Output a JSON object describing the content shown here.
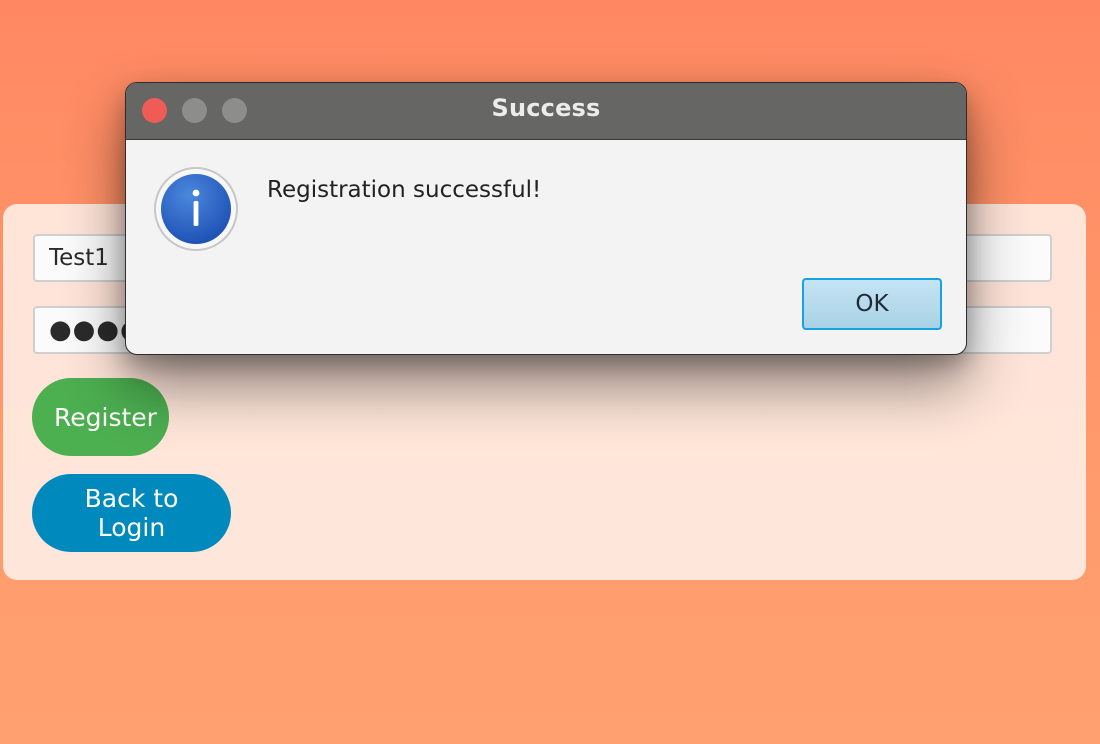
{
  "form": {
    "username_value": "Test1",
    "password_value": "●●●●●●●",
    "register_label": "Register",
    "back_label": "Back to Login"
  },
  "dialog": {
    "title": "Success",
    "message": "Registration successful!",
    "ok_label": "OK",
    "icon": "info-icon"
  },
  "colors": {
    "background_top": "#ff8862",
    "background_bottom": "#ffa070",
    "register_button": "#4caf50",
    "back_button": "#0089bd",
    "titlebar": "#666664",
    "close_dot": "#ee5c55",
    "ok_border": "#1aa2e0"
  }
}
